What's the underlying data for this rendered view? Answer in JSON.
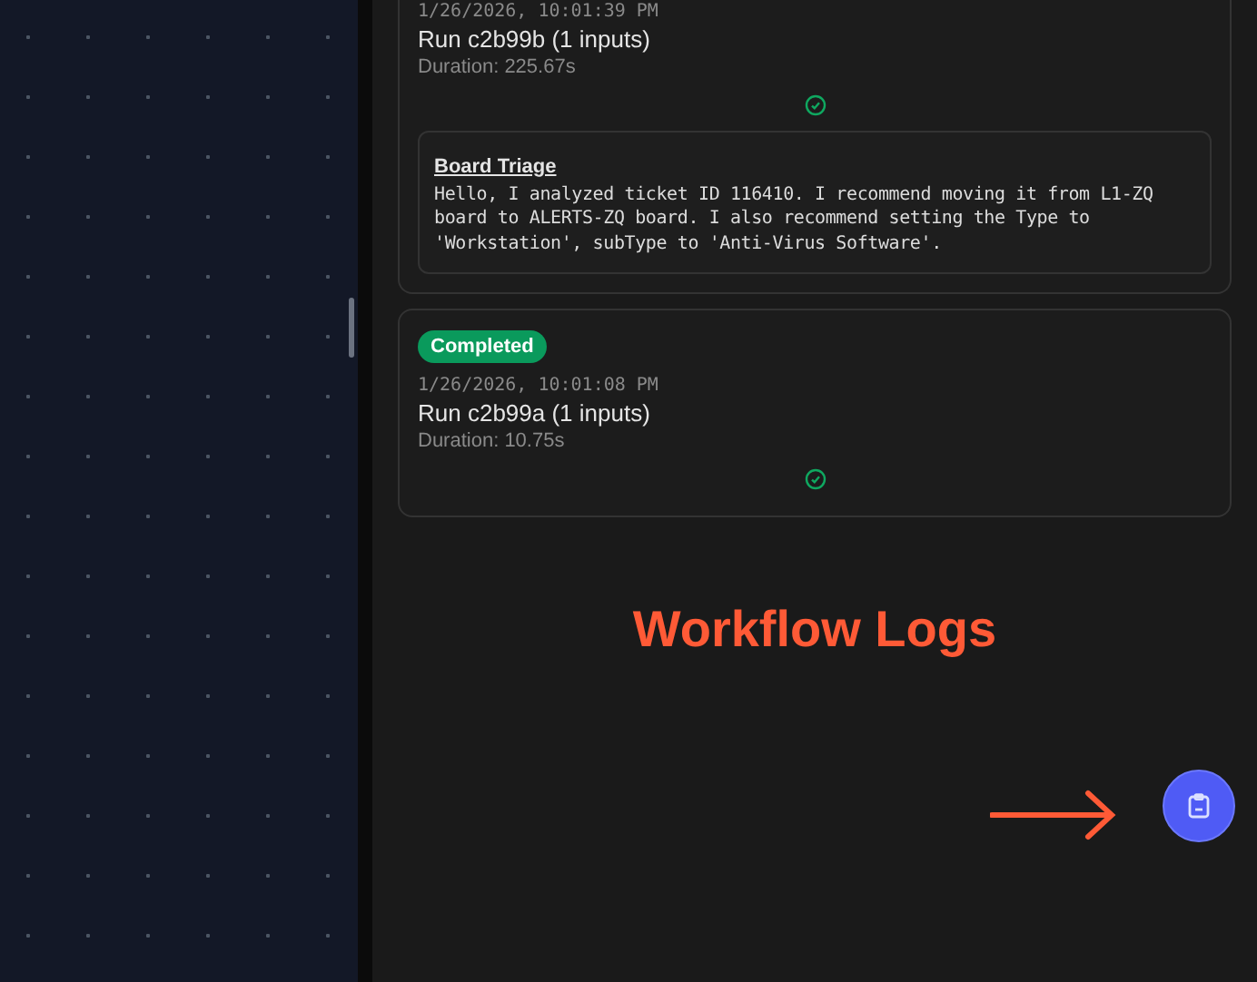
{
  "runs": [
    {
      "timestamp": "1/26/2026, 10:01:39 PM",
      "title": "Run c2b99b (1 inputs)",
      "duration": "Duration: 225.67s",
      "outputs": [
        {
          "title": "Board Triage",
          "text": "Hello, I analyzed ticket ID 116410. I recommend moving it from L1-ZQ board to ALERTS-ZQ board. I also recommend setting the Type to 'Workstation', subType to 'Anti-Virus Software'."
        }
      ]
    },
    {
      "status": "Completed",
      "timestamp": "1/26/2026, 10:01:08 PM",
      "title": "Run c2b99a (1 inputs)",
      "duration": "Duration: 10.75s"
    }
  ],
  "annotation": {
    "text": "Workflow Logs"
  }
}
